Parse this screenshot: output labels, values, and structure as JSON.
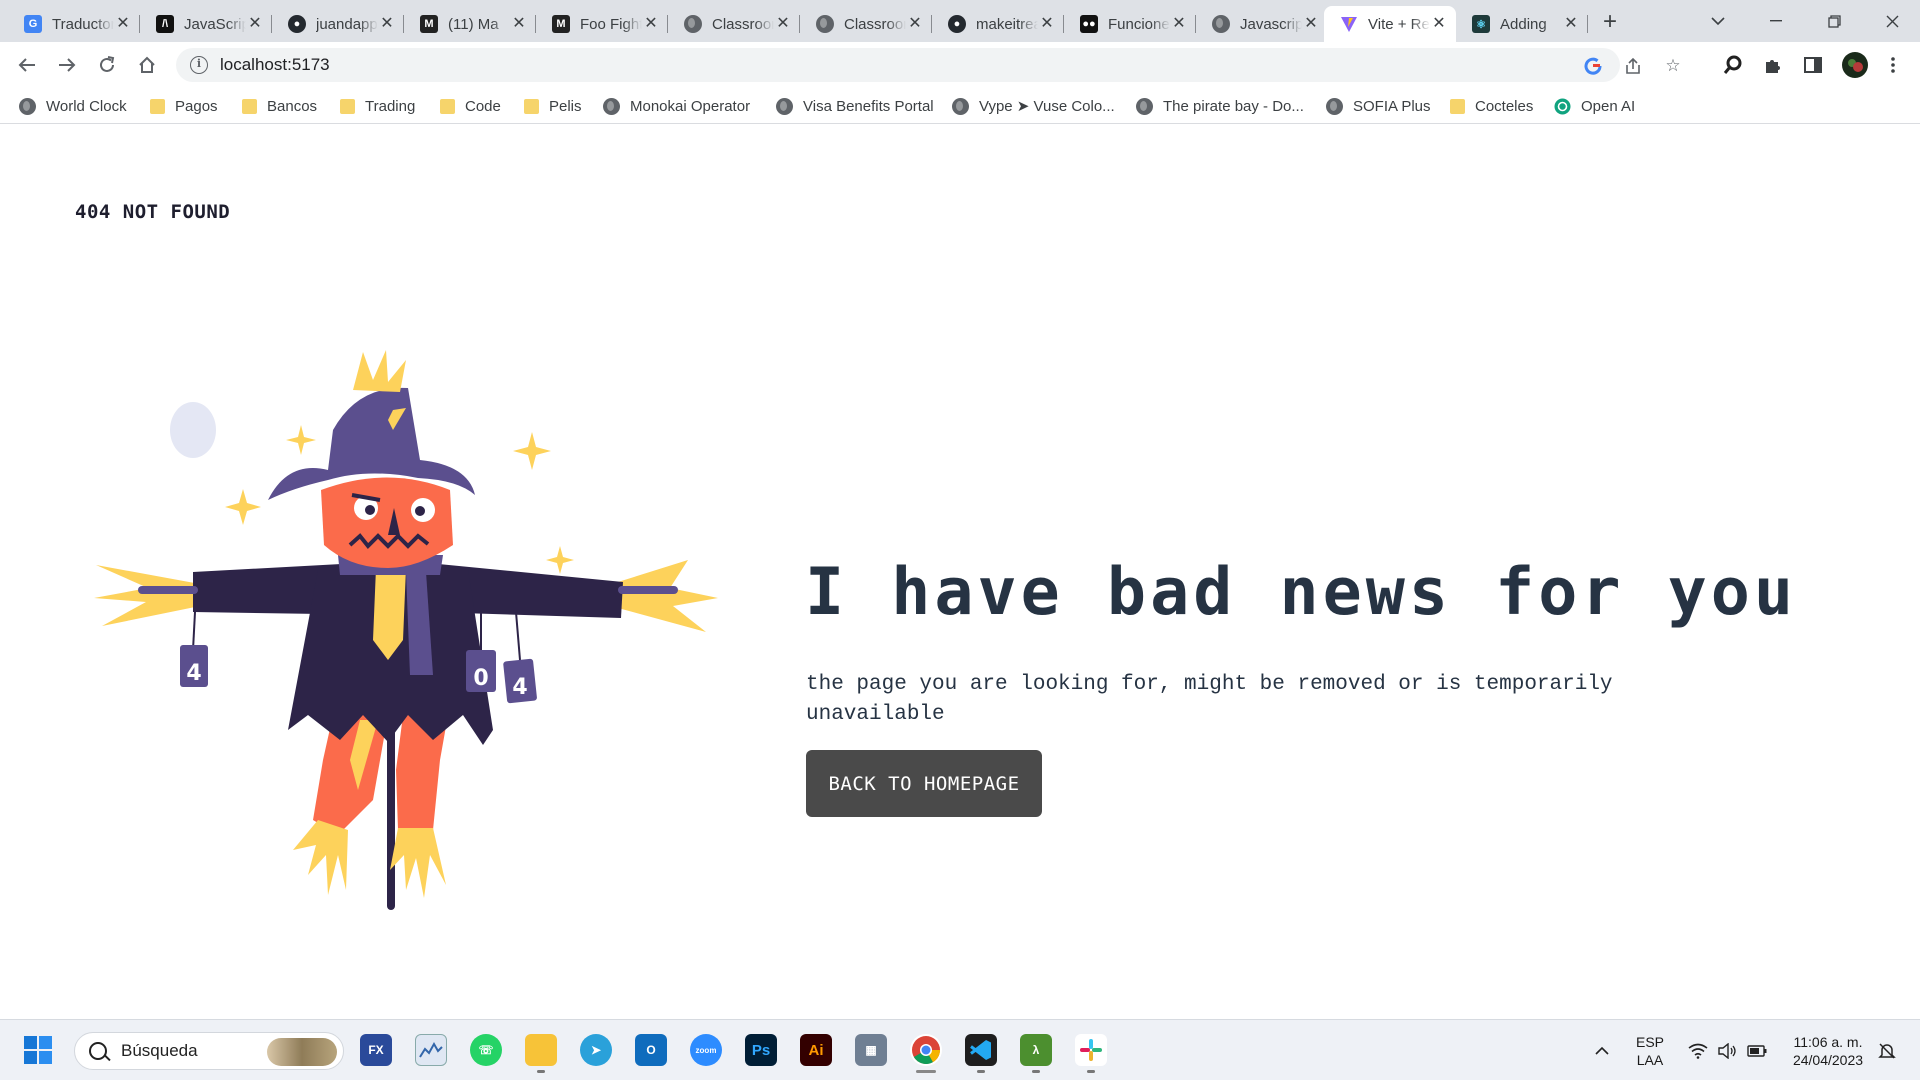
{
  "browser": {
    "tabs": [
      {
        "title": "Traductor",
        "favicon": "google-translate",
        "color": "#4285f4"
      },
      {
        "title": "JavaScript",
        "favicon": "javascript-info",
        "color": "#111111"
      },
      {
        "title": "juandapp",
        "favicon": "github",
        "color": "#24292f"
      },
      {
        "title": "(11) Ma",
        "favicon": "medium",
        "color": "#222222"
      },
      {
        "title": "Foo Fighters",
        "favicon": "medium",
        "color": "#222222"
      },
      {
        "title": "Classroom",
        "favicon": "globe",
        "color": "#5f6368"
      },
      {
        "title": "Classroom",
        "favicon": "globe",
        "color": "#5f6368"
      },
      {
        "title": "makeitreal",
        "favicon": "github",
        "color": "#24292f"
      },
      {
        "title": "Funciones",
        "favicon": "medium",
        "color": "#111111"
      },
      {
        "title": "Javascript",
        "favicon": "globe",
        "color": "#5f6368"
      },
      {
        "title": "Vite + React",
        "favicon": "vite",
        "color": "#8a63f7"
      },
      {
        "title": "Adding",
        "favicon": "react",
        "color": "#1e3a3a"
      }
    ],
    "active_tab_index": 10,
    "url": "localhost:5173",
    "bookmarks": [
      {
        "label": "World Clock",
        "kind": "globe"
      },
      {
        "label": "Pagos",
        "kind": "folder"
      },
      {
        "label": "Bancos",
        "kind": "folder"
      },
      {
        "label": "Trading",
        "kind": "folder"
      },
      {
        "label": "Code",
        "kind": "folder"
      },
      {
        "label": "Pelis",
        "kind": "folder"
      },
      {
        "label": "Monokai Operator",
        "kind": "globe"
      },
      {
        "label": "Visa Benefits Portal",
        "kind": "globe"
      },
      {
        "label": "Vype ➤ Vuse Colo...",
        "kind": "globe"
      },
      {
        "label": "The pirate bay - Do...",
        "kind": "globe"
      },
      {
        "label": "SOFIA Plus",
        "kind": "globe"
      },
      {
        "label": "Cocteles",
        "kind": "folder"
      },
      {
        "label": "Open AI",
        "kind": "openai"
      }
    ]
  },
  "page": {
    "error_code": "404 NOT FOUND",
    "headline": "I have bad news for you",
    "message": "the page you are looking for, might be removed or is temporarily unavailable",
    "button_label": "BACK TO HOMEPAGE",
    "can_labels": [
      "4",
      "0",
      "4"
    ],
    "colors": {
      "text": "#263343",
      "button": "#4a4a4a",
      "hat": "#5b4f8e",
      "coat": "#2d2448",
      "face": "#fb6b4b",
      "straw": "#fdd25b"
    }
  },
  "taskbar": {
    "search_placeholder": "Búsqueda",
    "apps": [
      "fx-choice",
      "stock-monitor",
      "whatsapp",
      "file-explorer",
      "telegram",
      "outlook",
      "zoom",
      "photoshop",
      "illustrator",
      "calculator",
      "chrome",
      "vscode",
      "lambda-app",
      "slack"
    ],
    "app_labels": {
      "fx": "FX",
      "zoom": "zoom",
      "ps": "Ps",
      "ai": "Ai"
    },
    "language": "ESP",
    "layout": "LAA",
    "time": "11:06 a. m.",
    "date": "24/04/2023"
  }
}
